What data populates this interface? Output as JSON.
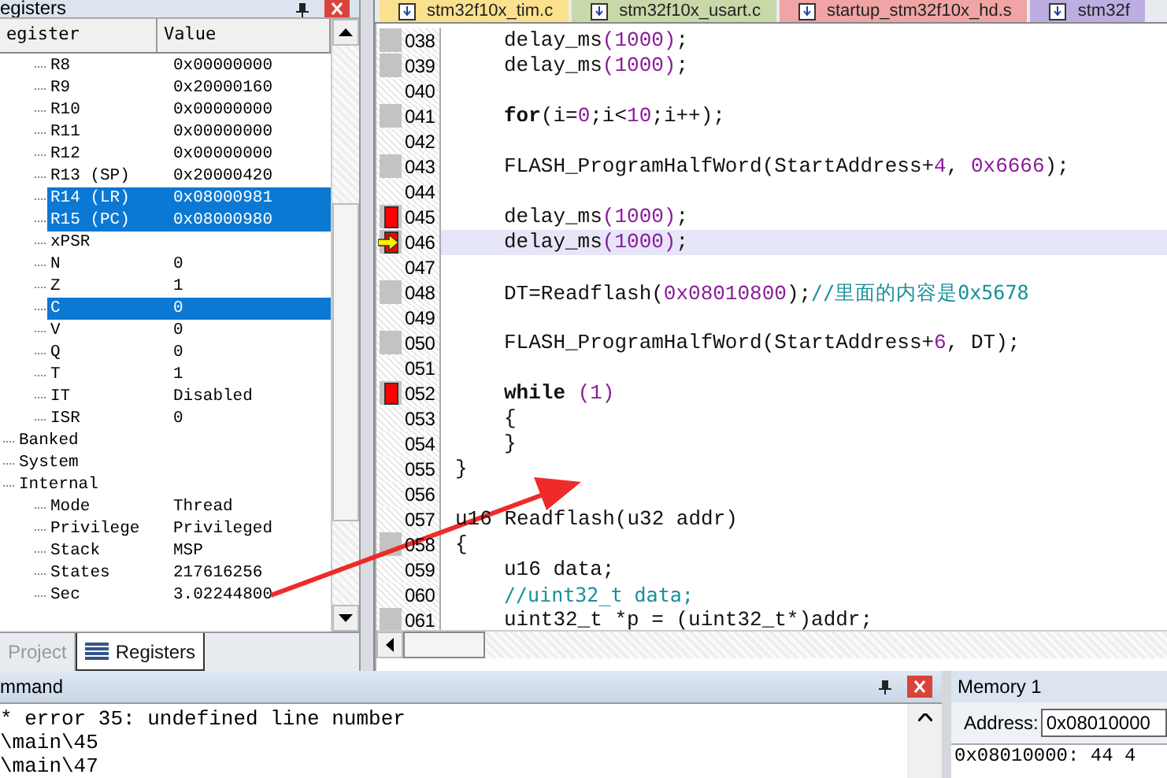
{
  "registers_panel": {
    "title": "egisters",
    "columns": [
      "egister",
      "Value"
    ],
    "rows": [
      {
        "children": [
          {
            "name": "R8",
            "value": "0x00000000",
            "selected": false
          },
          {
            "name": "R9",
            "value": "0x20000160",
            "selected": false
          },
          {
            "name": "R10",
            "value": "0x00000000",
            "selected": false
          },
          {
            "name": "R11",
            "value": "0x00000000",
            "selected": false
          },
          {
            "name": "R12",
            "value": "0x00000000",
            "selected": false
          },
          {
            "name": "R13 (SP)",
            "value": "0x20000420",
            "selected": false
          },
          {
            "name": "R14 (LR)",
            "value": "0x08000981",
            "selected": true
          },
          {
            "name": "R15 (PC)",
            "value": "0x08000980",
            "selected": true
          },
          {
            "name": "xPSR",
            "selected": false
          },
          {
            "name": "N",
            "value": "0",
            "selected": false
          },
          {
            "name": "Z",
            "value": "1",
            "selected": false
          },
          {
            "name": "C",
            "value": "0",
            "selected": true
          },
          {
            "name": "V",
            "value": "0",
            "selected": false
          },
          {
            "name": "Q",
            "value": "0",
            "selected": false
          },
          {
            "name": "T",
            "value": "1",
            "selected": false
          },
          {
            "name": "IT",
            "value": "Disabled",
            "selected": false
          },
          {
            "name": "ISR",
            "value": "0",
            "selected": false
          }
        ]
      },
      {
        "name": "Banked",
        "selected": false
      },
      {
        "name": "System",
        "selected": false
      },
      {
        "name": "Internal",
        "selected": false,
        "children": [
          {
            "name": "Mode",
            "value": "Thread",
            "selected": false
          },
          {
            "name": "Privilege",
            "value": "Privileged",
            "selected": false
          },
          {
            "name": "Stack",
            "value": "MSP",
            "selected": false
          },
          {
            "name": "States",
            "value": "217616256",
            "selected": false
          },
          {
            "name": "Sec",
            "value": "3.02244800",
            "selected": false
          }
        ]
      }
    ],
    "tabs": [
      {
        "label": "Project",
        "selected": false
      },
      {
        "label": "Registers",
        "selected": true
      }
    ]
  },
  "editor": {
    "tabs": [
      {
        "label": "stm32f10x_tim.c",
        "color": "#fbe18e"
      },
      {
        "label": "stm32f10x_usart.c",
        "color": "#c8d8a8"
      },
      {
        "label": "startup_stm32f10x_hd.s",
        "color": "#f0a4a4"
      },
      {
        "label": "stm32f",
        "color": "#bcaee0"
      }
    ],
    "lines": [
      {
        "number": "038",
        "indented": true,
        "executable": true,
        "segments": [
          {
            "text": "delay_ms",
            "kind": "plain"
          },
          {
            "text": "(1000)",
            "kind": "number"
          },
          {
            "text": ";",
            "kind": "plain"
          }
        ]
      },
      {
        "number": "039",
        "indented": true,
        "executable": true,
        "segments": [
          {
            "text": "delay_ms",
            "kind": "plain"
          },
          {
            "text": "(1000)",
            "kind": "number"
          },
          {
            "text": ";",
            "kind": "plain"
          }
        ]
      },
      {
        "number": "040"
      },
      {
        "number": "041",
        "indented": true,
        "executable": true,
        "segments": [
          {
            "text": "for",
            "kind": "keyword"
          },
          {
            "text": "(i=",
            "kind": "plain"
          },
          {
            "text": "0",
            "kind": "number"
          },
          {
            "text": ";i<",
            "kind": "plain"
          },
          {
            "text": "10",
            "kind": "number"
          },
          {
            "text": ";i++);",
            "kind": "plain"
          }
        ]
      },
      {
        "number": "042"
      },
      {
        "number": "043",
        "indented": true,
        "executable": true,
        "segments": [
          {
            "text": "FLASH_ProgramHalfWord(StartAddress+",
            "kind": "plain"
          },
          {
            "text": "4",
            "kind": "number"
          },
          {
            "text": ", ",
            "kind": "plain"
          },
          {
            "text": "0x6666",
            "kind": "number"
          },
          {
            "text": ");",
            "kind": "plain"
          }
        ]
      },
      {
        "number": "044"
      },
      {
        "number": "045",
        "indented": true,
        "executable": true,
        "breakpoint": true,
        "segments": [
          {
            "text": "delay_ms",
            "kind": "plain"
          },
          {
            "text": "(1000)",
            "kind": "number"
          },
          {
            "text": ";",
            "kind": "plain"
          }
        ]
      },
      {
        "number": "046",
        "indented": true,
        "executable": true,
        "breakpoint": true,
        "current": true,
        "segments": [
          {
            "text": "delay_ms",
            "kind": "plain"
          },
          {
            "text": "(1000)",
            "kind": "number"
          },
          {
            "text": ";",
            "kind": "plain"
          }
        ]
      },
      {
        "number": "047"
      },
      {
        "number": "048",
        "indented": true,
        "executable": true,
        "segments": [
          {
            "text": "DT=Readflash(",
            "kind": "plain"
          },
          {
            "text": "0x08010800",
            "kind": "number"
          },
          {
            "text": ");",
            "kind": "plain"
          },
          {
            "text": "//里面的内容是0x5678",
            "kind": "comment"
          }
        ]
      },
      {
        "number": "049"
      },
      {
        "number": "050",
        "indented": true,
        "executable": true,
        "segments": [
          {
            "text": "FLASH_ProgramHalfWord(StartAddress+",
            "kind": "plain"
          },
          {
            "text": "6",
            "kind": "number"
          },
          {
            "text": ", DT);",
            "kind": "plain"
          }
        ]
      },
      {
        "number": "051"
      },
      {
        "number": "052",
        "indented": true,
        "executable": true,
        "breakpoint": true,
        "segments": [
          {
            "text": "while",
            "kind": "keyword"
          },
          {
            "text": " (1)",
            "kind": "number"
          }
        ]
      },
      {
        "number": "053",
        "indented": true,
        "segments": [
          {
            "text": "{",
            "kind": "plain"
          }
        ]
      },
      {
        "number": "054",
        "indented": true,
        "segments": [
          {
            "text": "}",
            "kind": "plain"
          }
        ]
      },
      {
        "number": "055",
        "segments": [
          {
            "text": "}",
            "kind": "plain"
          }
        ]
      },
      {
        "number": "056"
      },
      {
        "number": "057",
        "segments": [
          {
            "text": "u16 Readflash(u32 addr)",
            "kind": "plain"
          }
        ]
      },
      {
        "number": "058",
        "executable": true,
        "segments": [
          {
            "text": "{",
            "kind": "plain"
          }
        ]
      },
      {
        "number": "059",
        "indented": true,
        "segments": [
          {
            "text": "u16 data;",
            "kind": "plain"
          }
        ]
      },
      {
        "number": "060",
        "indented": true,
        "segments": [
          {
            "text": "//uint32_t data;",
            "kind": "comment"
          }
        ]
      },
      {
        "number": "061",
        "indented": true,
        "executable": true,
        "segments": [
          {
            "text": "uint32_t *p = (uint32_t*)addr;",
            "kind": "plain"
          }
        ]
      }
    ]
  },
  "command_panel": {
    "title": "mmand",
    "lines": [
      "* error 35: undefined line number",
      "\\main\\45",
      "\\main\\47"
    ]
  },
  "memory_panel": {
    "title": "Memory 1",
    "address_label": "Address:",
    "address_value": "0x08010000",
    "first_line": "0x08010000: 44 4"
  }
}
